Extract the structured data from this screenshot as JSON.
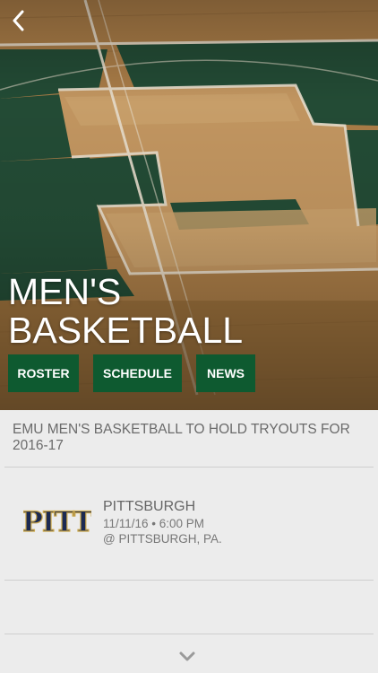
{
  "hero": {
    "title_line1": "MEN'S",
    "title_line2": "BASKETBALL",
    "buttons": [
      {
        "label": "ROSTER"
      },
      {
        "label": "SCHEDULE"
      },
      {
        "label": "NEWS"
      }
    ]
  },
  "news": {
    "headline": "EMU MEN'S BASKETBALL TO HOLD TRYOUTS FOR 2016-17"
  },
  "game": {
    "logo_text": "PITT",
    "opponent": "PITTSBURGH",
    "datetime": "11/11/16 • 6:00 PM",
    "location": "@ PITTSBURGH, PA."
  },
  "colors": {
    "accent_green": "#0e5a30",
    "court_wood": "#b98b55",
    "court_green": "#234b35",
    "pitt_navy": "#1c2a52",
    "pitt_gold": "#c9a64a"
  },
  "icons": {
    "back": "chevron-left-icon",
    "more": "chevron-down-icon"
  }
}
